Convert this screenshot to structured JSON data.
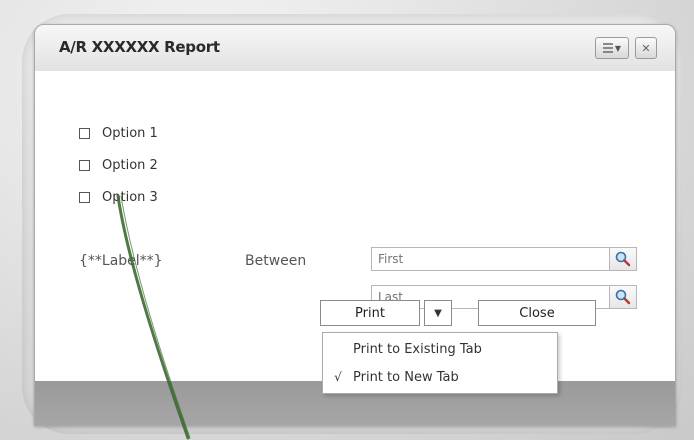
{
  "dialog": {
    "title": "A/R XXXXXX Report",
    "close_glyph": "✕"
  },
  "options": [
    {
      "label": "Option 1",
      "checked": false
    },
    {
      "label": "Option 2",
      "checked": false
    },
    {
      "label": "Option 3",
      "checked": false
    }
  ],
  "range": {
    "label": "{**Label**}",
    "operator": "Between",
    "first_placeholder": "First",
    "last_placeholder": "Last"
  },
  "buttons": {
    "print": "Print",
    "close": "Close",
    "print_dropdown_glyph": "▼"
  },
  "print_menu": {
    "items": [
      {
        "label": "Print to Existing Tab",
        "checked": false
      },
      {
        "label": "Print to New Tab",
        "checked": true
      }
    ],
    "check_glyph": "√"
  },
  "colors": {
    "stroke": "#3d6b2f",
    "footer": "#a0a0a0"
  },
  "icons": [
    "menu-options-icon",
    "close-icon",
    "magnifier-icon",
    "dropdown-arrow-icon"
  ]
}
